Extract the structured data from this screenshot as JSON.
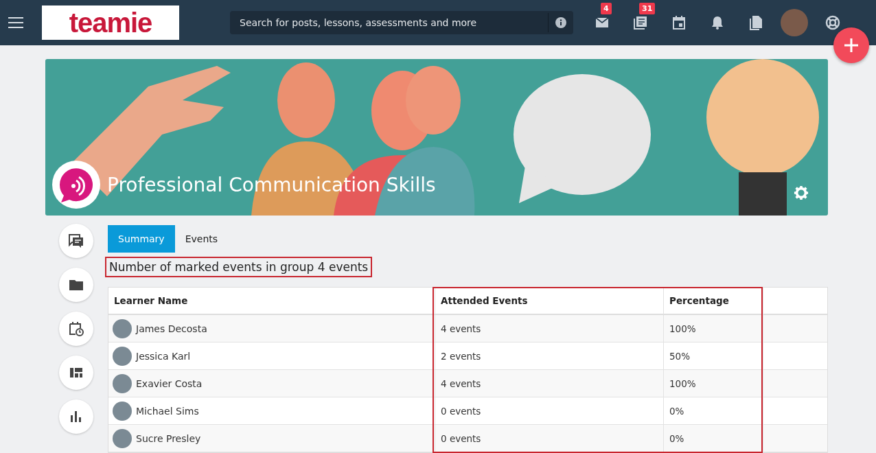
{
  "topbar": {
    "logo": "teamie",
    "search": {
      "placeholder": "Search for posts, lessons, assessments and more"
    },
    "icons": [
      {
        "kind": "mail",
        "badge": "4"
      },
      {
        "kind": "news",
        "badge": "31"
      },
      {
        "kind": "calendar"
      },
      {
        "kind": "bell"
      },
      {
        "kind": "docs"
      },
      {
        "kind": "avatar"
      },
      {
        "kind": "help"
      }
    ]
  },
  "group": {
    "title": "Professional Communication Skills"
  },
  "sidebar": {
    "items": [
      {
        "kind": "discussion"
      },
      {
        "kind": "folder"
      },
      {
        "kind": "schedule"
      },
      {
        "kind": "dashboard"
      },
      {
        "kind": "chart"
      }
    ]
  },
  "tabs": [
    {
      "label": "Summary",
      "selected": true
    },
    {
      "label": "Events",
      "selected": false
    }
  ],
  "summary": {
    "text": "Number of marked events in group 4 events",
    "outlined": true
  },
  "table": {
    "columns": [
      {
        "label": "Learner Name",
        "outlined": false
      },
      {
        "label": "Attended Events",
        "outlined": true
      },
      {
        "label": "Percentage",
        "outlined": true
      }
    ],
    "rows": [
      {
        "name": "James Decosta",
        "attended": "4 events",
        "percentage": "100%"
      },
      {
        "name": "Jessica Karl",
        "attended": "2 events",
        "percentage": "50%"
      },
      {
        "name": "Exavier Costa",
        "attended": "4 events",
        "percentage": "100%"
      },
      {
        "name": "Michael Sims",
        "attended": "0 events",
        "percentage": "0%"
      },
      {
        "name": "Sucre Presley",
        "attended": "0 events",
        "percentage": "0%"
      }
    ]
  }
}
